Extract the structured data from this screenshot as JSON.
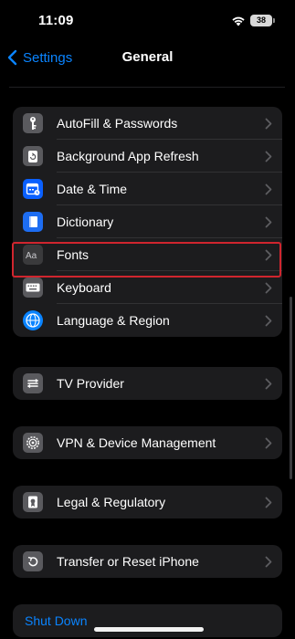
{
  "status_bar": {
    "time": "11:09",
    "battery": "38"
  },
  "nav": {
    "back_label": "Settings",
    "title": "General"
  },
  "group_main": [
    {
      "label": "AutoFill & Passwords",
      "icon": "key-icon"
    },
    {
      "label": "Background App Refresh",
      "icon": "refresh-icon"
    },
    {
      "label": "Date & Time",
      "icon": "calendar-clock-icon"
    },
    {
      "label": "Dictionary",
      "icon": "book-icon"
    },
    {
      "label": "Fonts",
      "icon": "fonts-icon",
      "highlighted": true
    },
    {
      "label": "Keyboard",
      "icon": "keyboard-icon"
    },
    {
      "label": "Language & Region",
      "icon": "globe-icon"
    }
  ],
  "tv_provider": {
    "label": "TV Provider",
    "icon": "tv-provider-icon"
  },
  "vpn": {
    "label": "VPN & Device Management",
    "icon": "gear-icon"
  },
  "legal": {
    "label": "Legal & Regulatory",
    "icon": "certificate-icon"
  },
  "transfer": {
    "label": "Transfer or Reset iPhone",
    "icon": "reset-icon"
  },
  "shutdown": {
    "label": "Shut Down"
  },
  "colors": {
    "accent": "#0a84ff",
    "highlight_border": "#d0252e",
    "cell_background": "#1c1c1e"
  }
}
